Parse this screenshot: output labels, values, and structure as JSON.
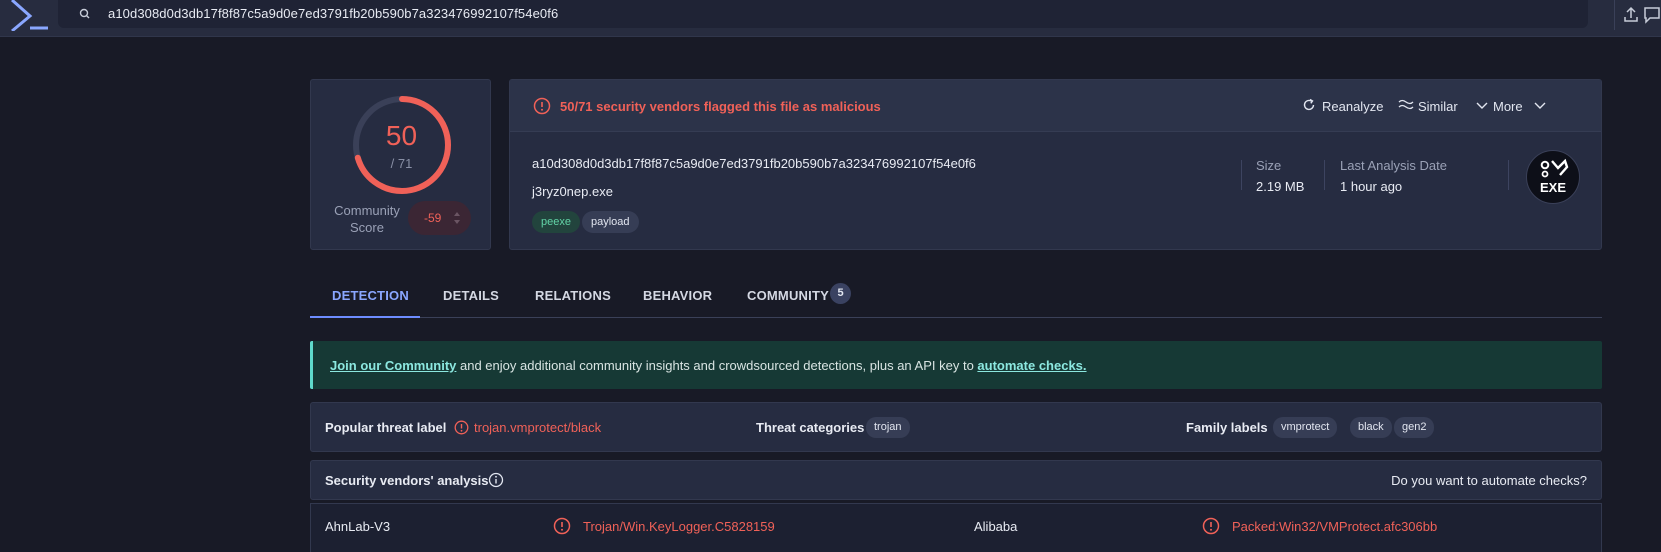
{
  "search": {
    "query": "a10d308d0d3db17f8f87c5a9d0e7ed3791fb20b590b7a323476992107f54e0f6"
  },
  "colors": {
    "malicious": "#f06158",
    "accent": "#6d8cff",
    "community": "#5fd9cb"
  },
  "score": {
    "detections": "50",
    "total": "/ 71",
    "detected_fraction": 0.704,
    "community_label": "Community Score",
    "community_value": "-59"
  },
  "summary": {
    "alert": "50/71 security vendors flagged this file as malicious",
    "actions": {
      "reanalyze": "Reanalyze",
      "similar": "Similar",
      "more": "More"
    },
    "hash": "a10d308d0d3db17f8f87c5a9d0e7ed3791fb20b590b7a323476992107f54e0f6",
    "filename": "j3ryz0nep.exe",
    "tags": [
      "peexe",
      "payload"
    ],
    "size_label": "Size",
    "size_value": "2.19 MB",
    "date_label": "Last Analysis Date",
    "date_value": "1 hour ago",
    "filetype": "EXE"
  },
  "tabs": [
    {
      "label": "DETECTION"
    },
    {
      "label": "DETAILS"
    },
    {
      "label": "RELATIONS"
    },
    {
      "label": "BEHAVIOR"
    },
    {
      "label": "COMMUNITY",
      "badge": "5"
    }
  ],
  "banner": {
    "link1": "Join our Community",
    "middle": " and enjoy additional community insights and crowdsourced detections, plus an API key to ",
    "link2": "automate checks."
  },
  "threat": {
    "popular_label": "Popular threat label",
    "popular_value": "trojan.vmprotect/black",
    "categories_label": "Threat categories",
    "categories": [
      "trojan"
    ],
    "family_label": "Family labels",
    "families": [
      "vmprotect",
      "black",
      "gen2"
    ]
  },
  "vendors": {
    "title": "Security vendors' analysis",
    "automate": "Do you want to automate checks?",
    "rows": [
      {
        "left_vendor": "AhnLab-V3",
        "left_result": "Trojan/Win.KeyLogger.C5828159",
        "right_vendor": "Alibaba",
        "right_result": "Packed:Win32/VMProtect.afc306bb"
      }
    ]
  }
}
